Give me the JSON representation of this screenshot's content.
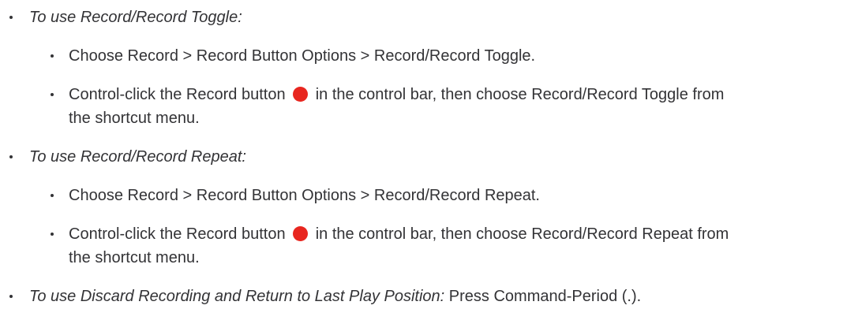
{
  "items": [
    {
      "heading": "To use Record/Record Toggle:",
      "steps": [
        {
          "text": "Choose Record > Record Button Options > Record/Record Toggle."
        },
        {
          "before": "Control-click the Record button",
          "icon": "record-button-icon",
          "after": "in the control bar, then choose Record/Record Toggle from the shortcut menu."
        }
      ]
    },
    {
      "heading": "To use Record/Record Repeat:",
      "steps": [
        {
          "text": "Choose Record > Record Button Options > Record/Record Repeat."
        },
        {
          "before": "Control-click the Record button",
          "icon": "record-button-icon",
          "after": "in the control bar, then choose Record/Record Repeat from the shortcut menu."
        }
      ]
    },
    {
      "heading": "To use Discard Recording and Return to Last Play Position:",
      "rest": "Press Command-Period (.)."
    }
  ],
  "colors": {
    "text": "#333336",
    "record_icon": "#e8261f"
  }
}
